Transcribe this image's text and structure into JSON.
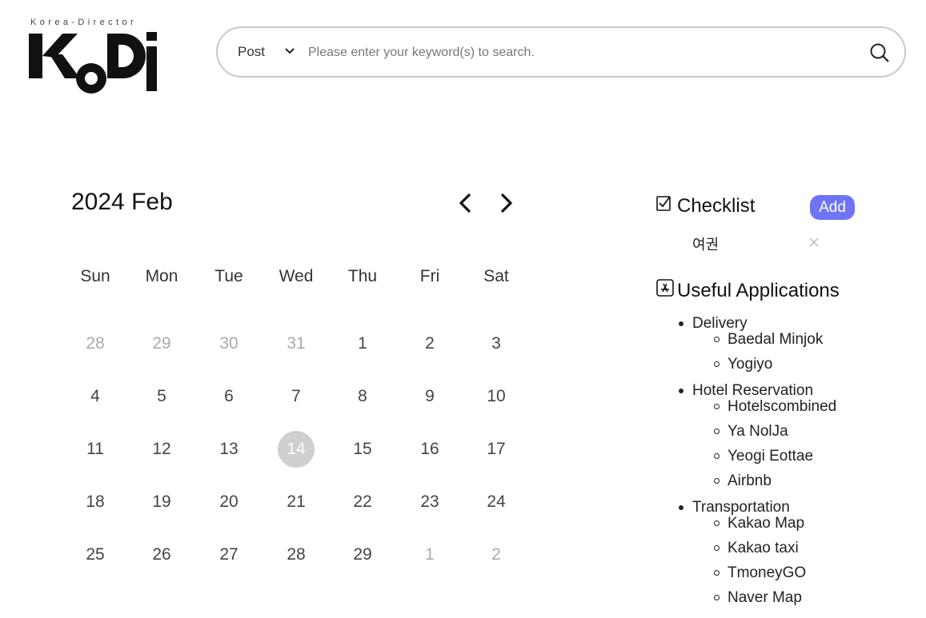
{
  "logo": {
    "tagline": "Korea-Director",
    "wordmark": "KoDi"
  },
  "search": {
    "category": "Post",
    "placeholder": "Please enter your keyword(s) to search.",
    "icons": {
      "dropdown": "chevron-down-icon",
      "submit": "search-icon"
    }
  },
  "calendar": {
    "title": "2024 Feb",
    "weekdays": [
      "Sun",
      "Mon",
      "Tue",
      "Wed",
      "Thu",
      "Fri",
      "Sat"
    ],
    "weeks": [
      [
        {
          "d": "28",
          "muted": true
        },
        {
          "d": "29",
          "muted": true
        },
        {
          "d": "30",
          "muted": true
        },
        {
          "d": "31",
          "muted": true
        },
        {
          "d": "1"
        },
        {
          "d": "2"
        },
        {
          "d": "3"
        }
      ],
      [
        {
          "d": "4"
        },
        {
          "d": "5"
        },
        {
          "d": "6"
        },
        {
          "d": "7"
        },
        {
          "d": "8"
        },
        {
          "d": "9"
        },
        {
          "d": "10"
        }
      ],
      [
        {
          "d": "11"
        },
        {
          "d": "12"
        },
        {
          "d": "13"
        },
        {
          "d": "14",
          "today": true
        },
        {
          "d": "15"
        },
        {
          "d": "16"
        },
        {
          "d": "17"
        }
      ],
      [
        {
          "d": "18"
        },
        {
          "d": "19"
        },
        {
          "d": "20"
        },
        {
          "d": "21"
        },
        {
          "d": "22"
        },
        {
          "d": "23"
        },
        {
          "d": "24"
        }
      ],
      [
        {
          "d": "25"
        },
        {
          "d": "26"
        },
        {
          "d": "27"
        },
        {
          "d": "28"
        },
        {
          "d": "29"
        },
        {
          "d": "1",
          "muted": true
        },
        {
          "d": "2",
          "muted": true
        }
      ]
    ],
    "icons": {
      "prev": "chevron-left-icon",
      "next": "chevron-right-icon"
    }
  },
  "checklist": {
    "heading": "Checklist",
    "add_label": "Add",
    "items": [
      "여권"
    ],
    "icons": {
      "heading": "checkbox-icon",
      "remove": "close-icon"
    },
    "colors": {
      "add_button": "#6f74f6"
    }
  },
  "apps": {
    "heading": "Useful Applications",
    "icons": {
      "heading": "app-store-icon"
    },
    "categories": [
      {
        "name": "Delivery",
        "items": [
          "Baedal Minjok",
          "Yogiyo"
        ]
      },
      {
        "name": "Hotel Reservation",
        "items": [
          "Hotelscombined",
          "Ya NolJa",
          "Yeogi Eottae",
          "Airbnb"
        ]
      },
      {
        "name": "Transportation",
        "items": [
          "Kakao Map",
          "Kakao taxi",
          "TmoneyGO",
          "Naver Map"
        ]
      }
    ]
  }
}
